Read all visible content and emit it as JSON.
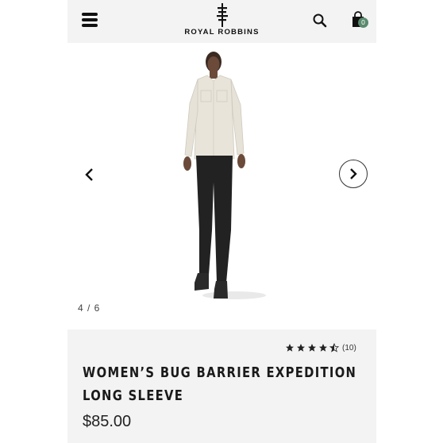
{
  "header": {
    "brand": "ROYAL ROBBINS",
    "cart_count": "0"
  },
  "icons": {
    "menu": "hamburger-menu-icon",
    "search": "search-icon",
    "bag": "shopping-bag-icon",
    "prev": "chevron-left-icon",
    "next": "chevron-right-icon",
    "star": "star-icon"
  },
  "gallery": {
    "counter": "4 / 6",
    "current_image": 4,
    "total_images": 6
  },
  "product": {
    "rating": 4.5,
    "rating_max": 5,
    "review_count": "(10)",
    "title_line1": "WOMEN’S BUG BARRIER EXPEDITION",
    "title_line2": "LONG SLEEVE",
    "price": "$85.00"
  },
  "colors": {
    "header_bg": "#f3f3f3",
    "info_bg": "#f3f3f3",
    "badge": "#5a8a6e",
    "text": "#1a1a1a"
  }
}
